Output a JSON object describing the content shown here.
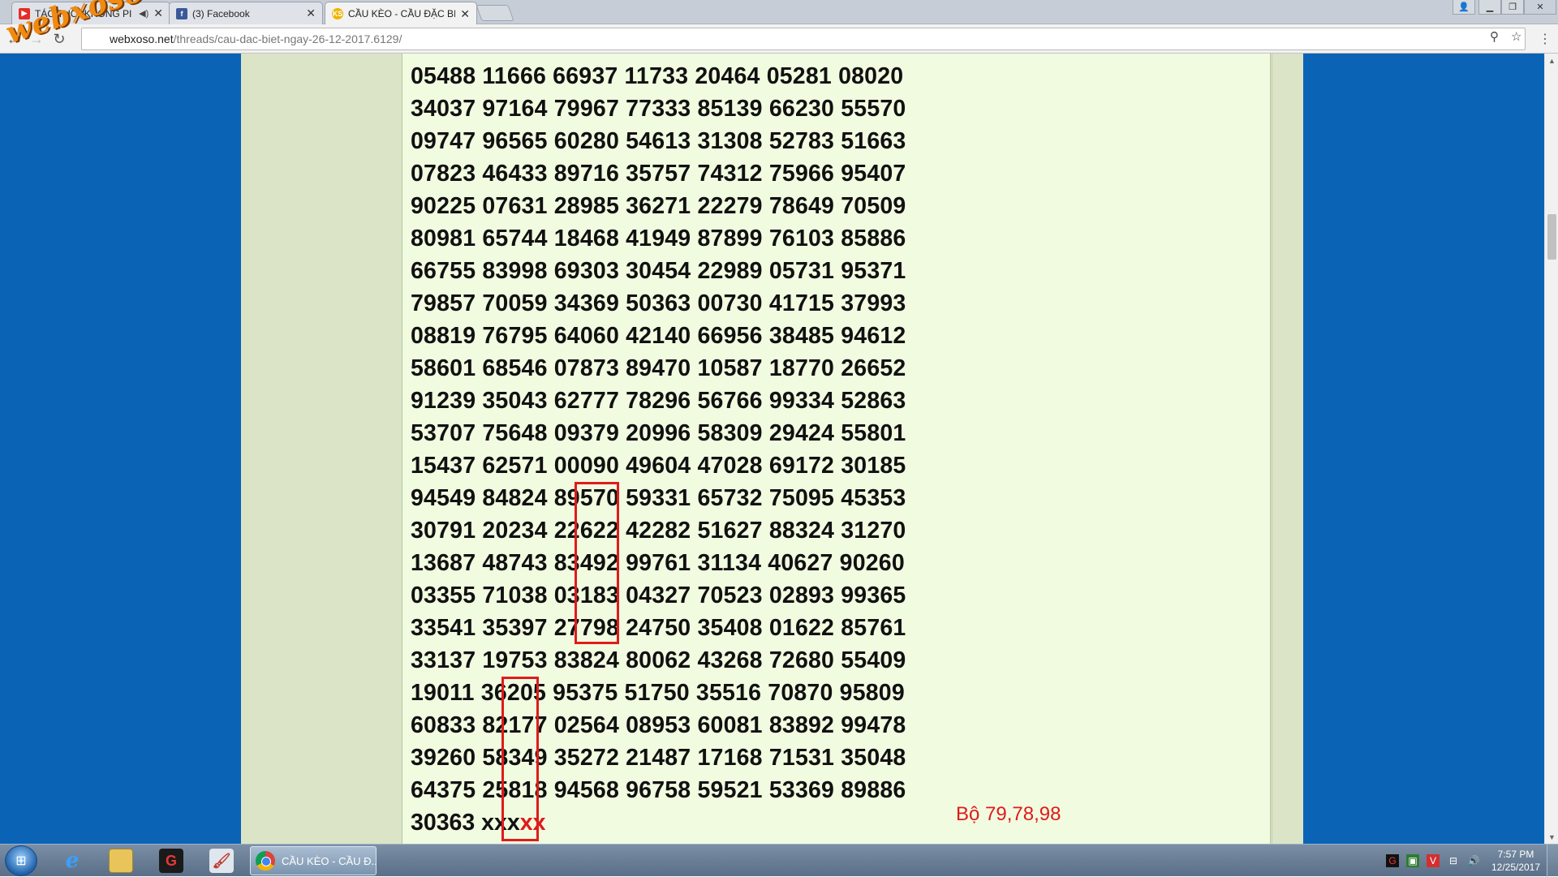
{
  "browser": {
    "tabs": [
      {
        "title": "TÁO THỔ \"KHÔNG PI",
        "icon": "youtube-icon",
        "has_audio": true
      },
      {
        "title": "(3) Facebook",
        "icon": "facebook-icon"
      },
      {
        "title": "CẦU KÈO - CẦU ĐẶC BIỆ",
        "icon": "site-favicon",
        "active": true
      }
    ],
    "address_prefix": "",
    "address_host": "webxoso.net",
    "address_path": "/threads/cau-dac-biet-ngay-26-12-2017.6129/"
  },
  "watermark": "webxoso.net",
  "post": {
    "rows": [
      "05488 11666 66937 11733 20464 05281 08020",
      "34037 97164 79967 77333 85139 66230 55570",
      "09747 96565 60280 54613 31308 52783 51663",
      "07823 46433 89716 35757 74312 75966 95407",
      "90225 07631 28985 36271 22279 78649 70509",
      "80981 65744 18468 41949 87899 76103 85886",
      "66755 83998 69303 30454 22989 05731 95371",
      "79857 70059 34369 50363 00730 41715 37993",
      "08819 76795 64060 42140 66956 38485 94612",
      "58601 68546 07873 89470 10587 18770 26652",
      "91239 35043 62777 78296 56766 99334 52863",
      "53707 75648 09379 20996 58309 29424 55801",
      "15437 62571 00090 49604 47028 69172 30185",
      "94549 84824 89570 59331 65732 75095 45353",
      "30791 20234 22622 42282 51627 88324 31270",
      "13687 48743 83492 99761 31134 40627 90260",
      "03355 71038 03183 04327 70523 02893 99365",
      "33541 35397 27798 24750 35408 01622 85761",
      "33137 19753 83824 80062 43268 72680 55409",
      "19011 36205 95375 51750 35516 70870 95809",
      "60833 82177 02564 08953 60081 83892 99478",
      "39260 58349 35272 21487 17168 71531 35048",
      "64375 25818 94568 96758 59521 53369 89886"
    ],
    "last_row_prefix": "30363 xxx",
    "last_row_red": "xx",
    "note": "Bộ 79,78,98",
    "highlight_color": "#e01b1b"
  },
  "taskbar": {
    "chrome_label": "CẦU KÈO - CẦU Đ...",
    "clock_time": "7:57 PM",
    "clock_date": "12/25/2017"
  },
  "colors": {
    "page_bg": "#0b63b6",
    "post_bg": "#f1fbe0",
    "accent_red": "#e01b1b"
  }
}
